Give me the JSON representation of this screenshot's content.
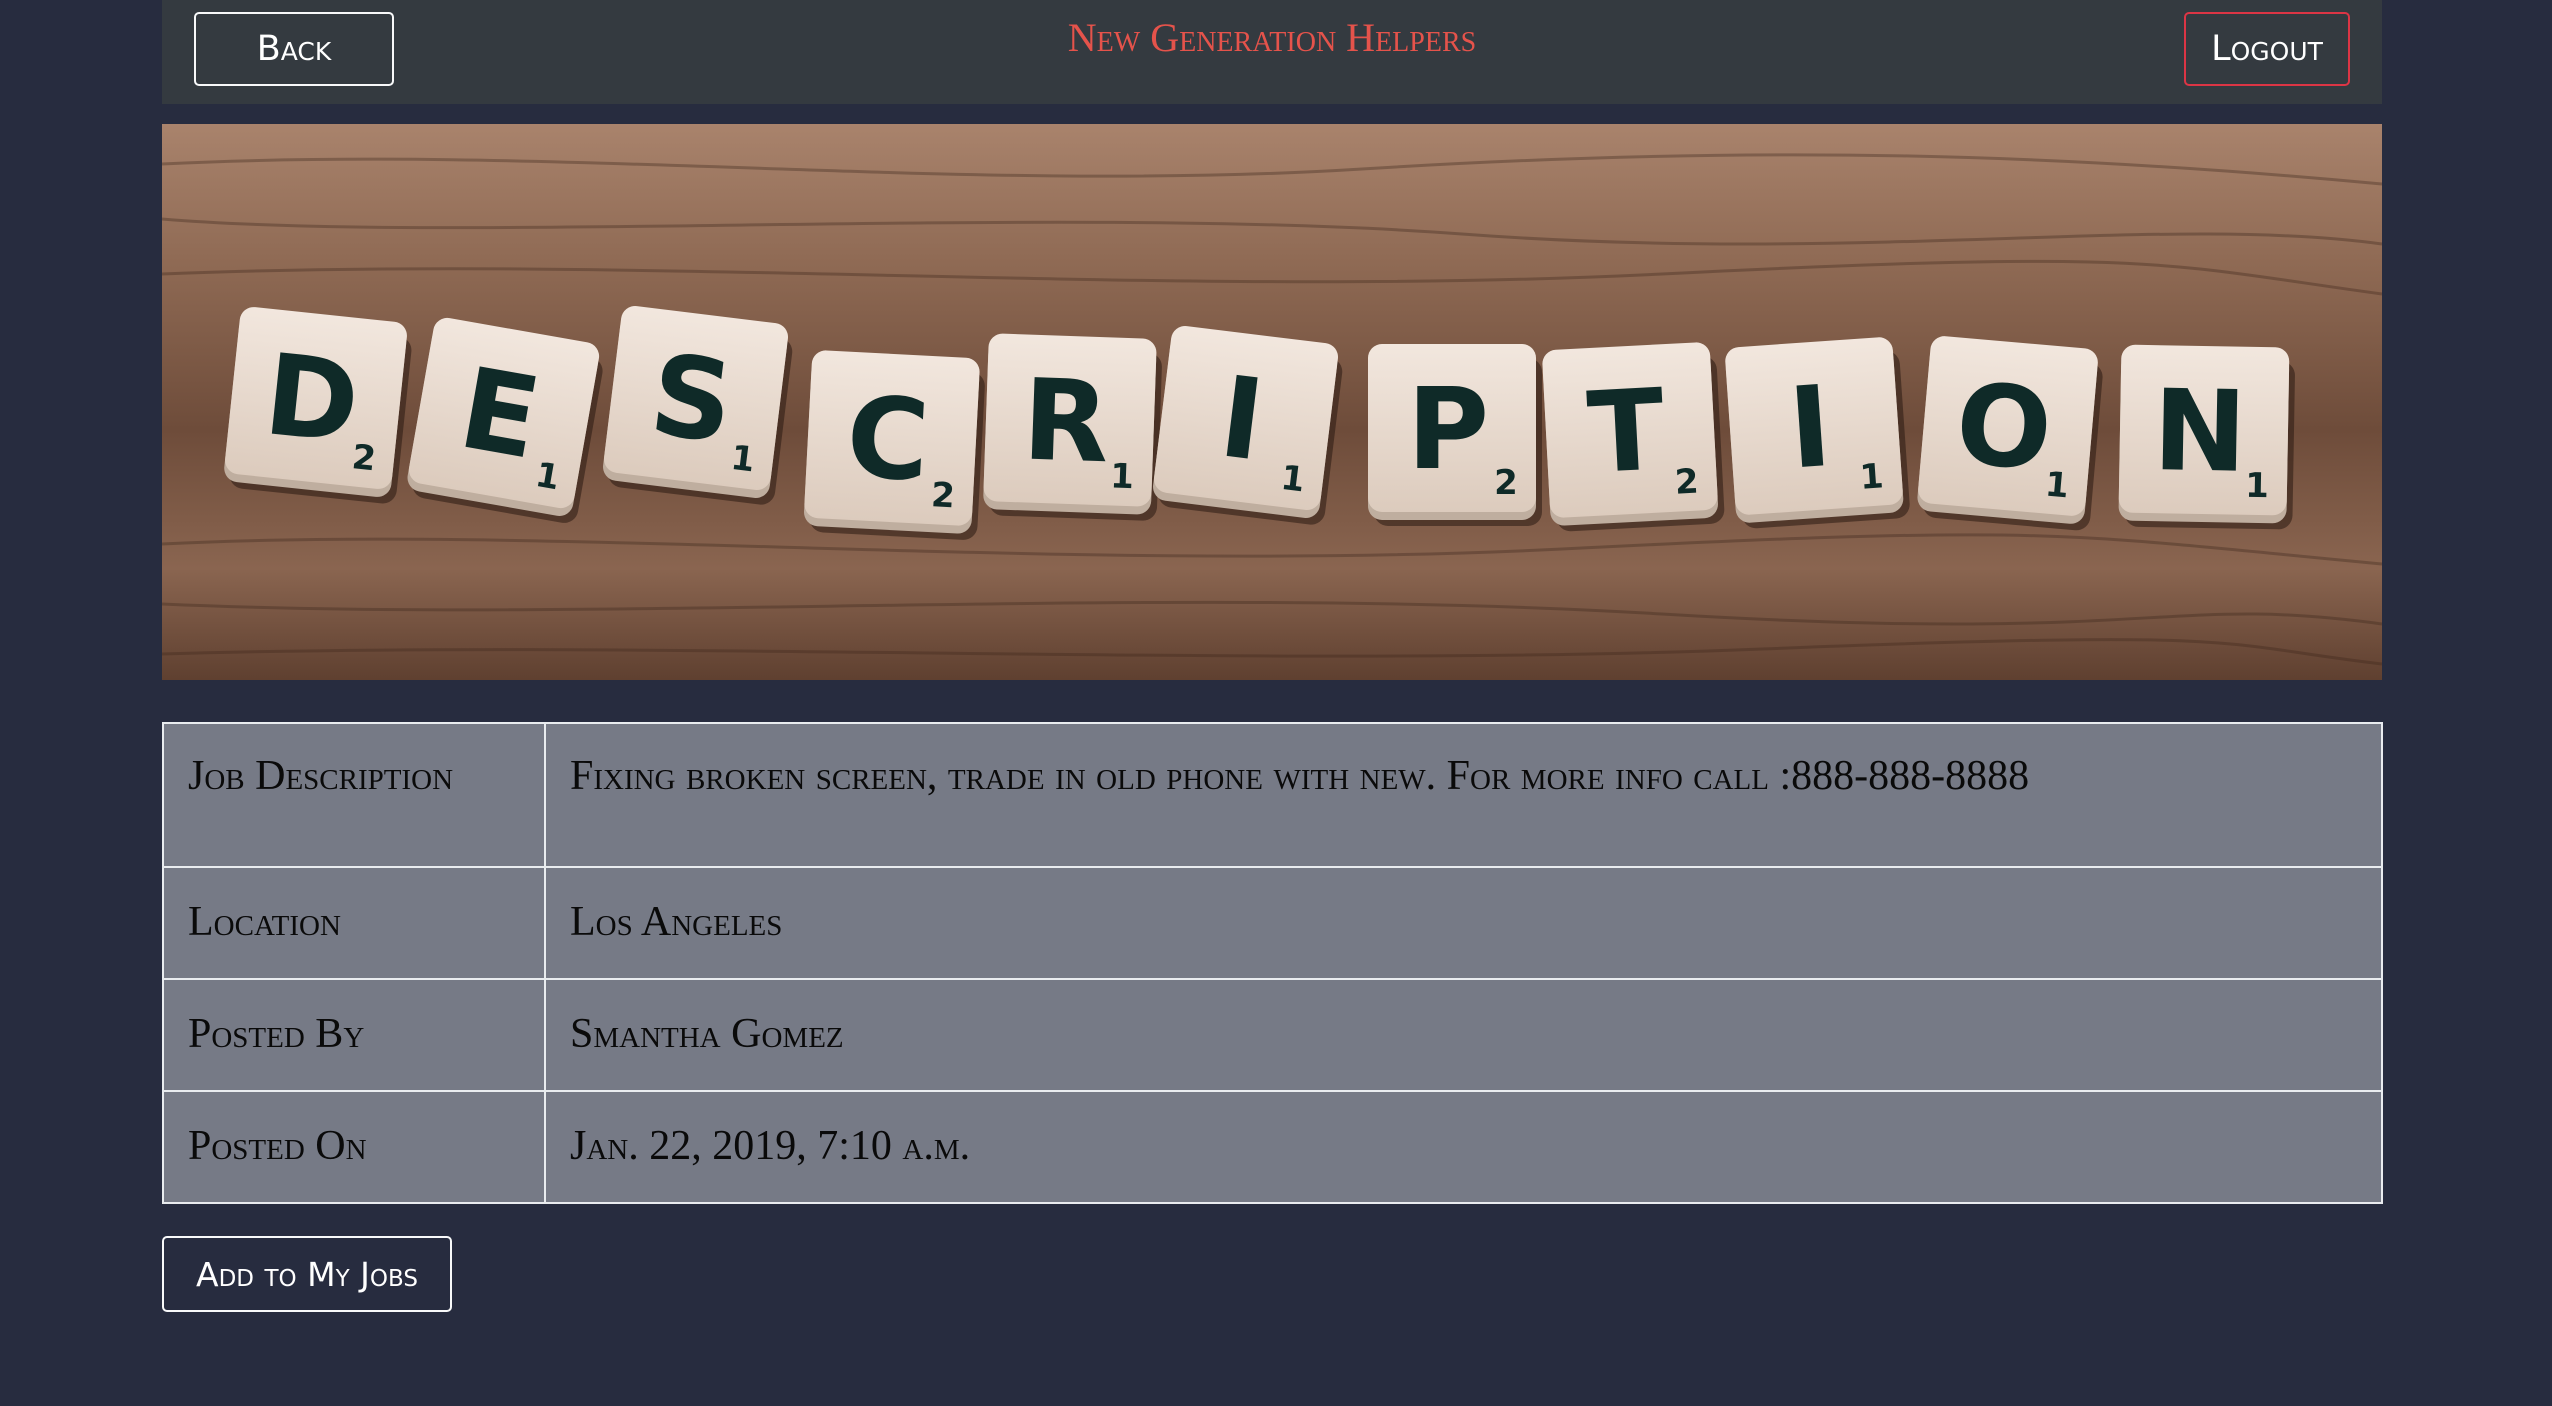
{
  "navbar": {
    "back_label": "Back",
    "brand": "New Generation Helpers",
    "logout_label": "Logout"
  },
  "banner": {
    "tiles": [
      {
        "letter": "D",
        "num": "2"
      },
      {
        "letter": "E",
        "num": "1"
      },
      {
        "letter": "S",
        "num": "1"
      },
      {
        "letter": "C",
        "num": "2"
      },
      {
        "letter": "R",
        "num": "1"
      },
      {
        "letter": "I",
        "num": "1"
      },
      {
        "letter": "P",
        "num": "2"
      },
      {
        "letter": "T",
        "num": "2"
      },
      {
        "letter": "I",
        "num": "1"
      },
      {
        "letter": "O",
        "num": "1"
      },
      {
        "letter": "N",
        "num": "1"
      }
    ]
  },
  "details": {
    "rows": [
      {
        "label": "Job Description",
        "value": "Fixing broken screen, trade in old phone with new. For more info call :888-888-8888"
      },
      {
        "label": "Location",
        "value": "Los Angeles"
      },
      {
        "label": "Posted By",
        "value": "Smantha Gomez"
      },
      {
        "label": "Posted On",
        "value": "Jan. 22, 2019, 7:10 a.m."
      }
    ]
  },
  "actions": {
    "add_label": "Add to My Jobs"
  },
  "colors": {
    "page_bg": "#272c3f",
    "navbar_bg": "#343a40",
    "brand": "#e5534b",
    "logout_border": "#dc3545",
    "table_bg": "#767a86"
  }
}
